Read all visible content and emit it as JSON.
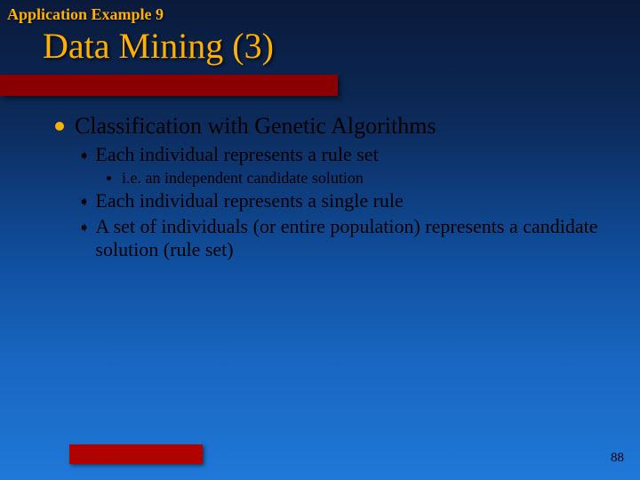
{
  "header": {
    "label": "Application Example 9"
  },
  "title": "Data Mining (3)",
  "bullets": {
    "l1a": "Classification with Genetic Algorithms",
    "l2a": "Each individual represents a rule set",
    "l3a": "i.e. an independent candidate solution",
    "l2b": "Each individual represents a single rule",
    "l2c": "A set of individuals (or entire population) represents a candidate solution (rule set)"
  },
  "page": "88"
}
